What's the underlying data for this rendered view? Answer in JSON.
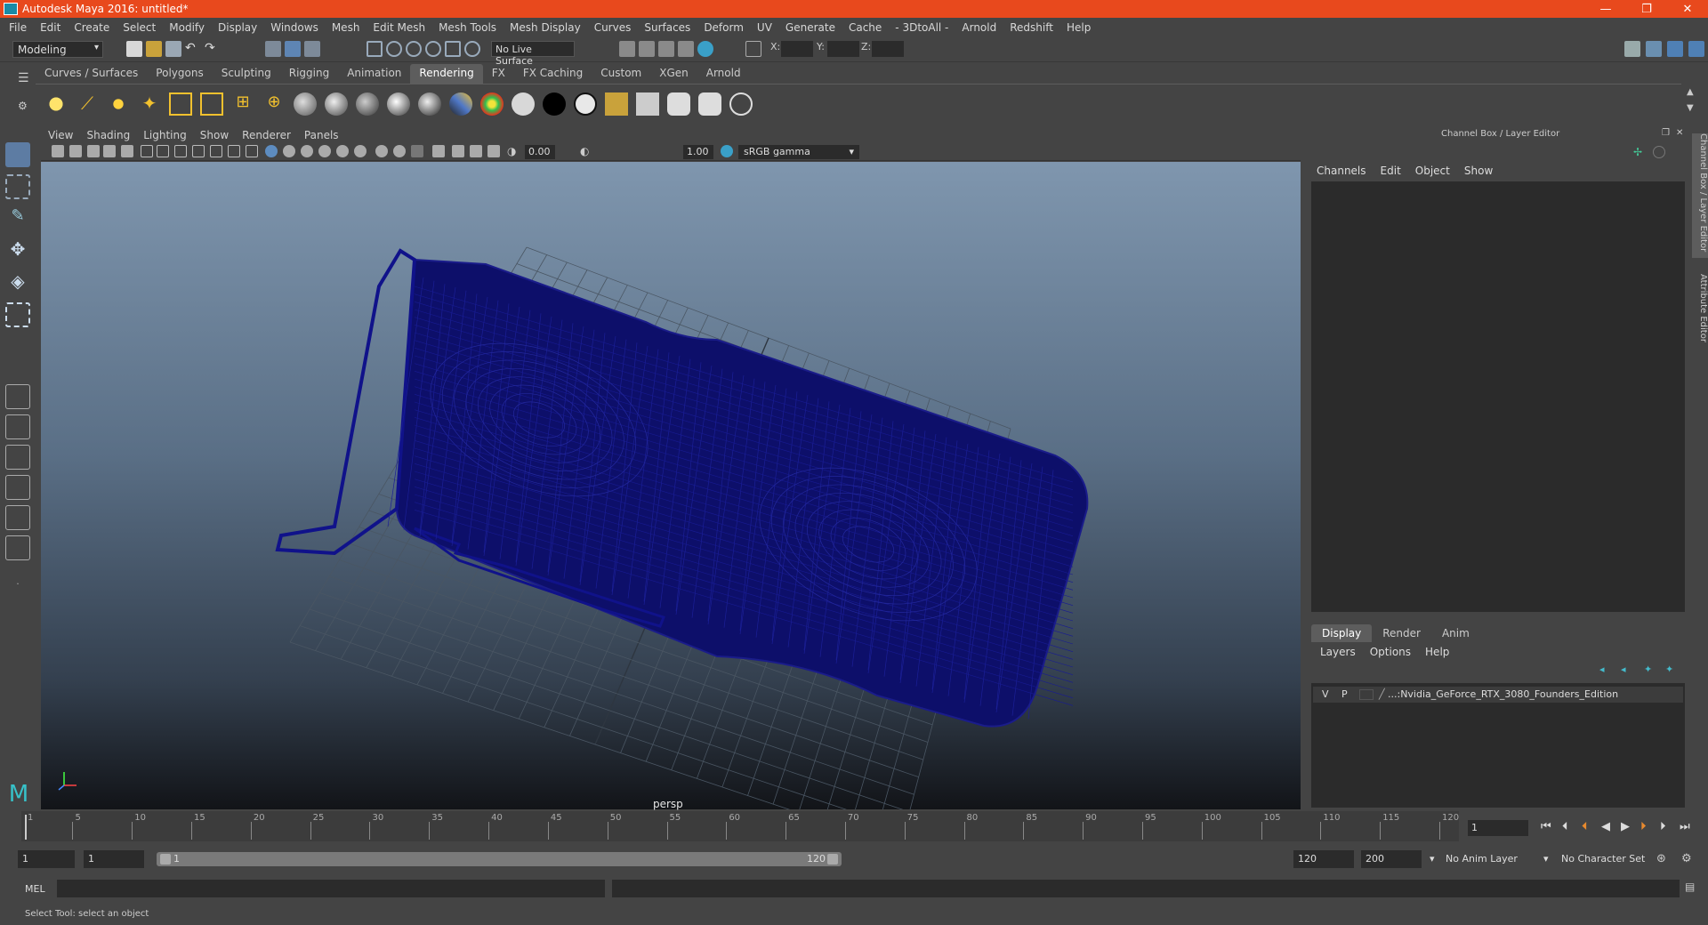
{
  "window": {
    "title": "Autodesk Maya 2016: untitled*",
    "buttons": [
      "—",
      "❐",
      "✕"
    ]
  },
  "menubar": [
    "File",
    "Edit",
    "Create",
    "Select",
    "Modify",
    "Display",
    "Windows",
    "Mesh",
    "Edit Mesh",
    "Mesh Tools",
    "Mesh Display",
    "Curves",
    "Surfaces",
    "Deform",
    "UV",
    "Generate",
    "Cache",
    "- 3DtoAll -",
    "Arnold",
    "Redshift",
    "Help"
  ],
  "statusline": {
    "mode": "Modeling",
    "live_surface": "No Live Surface",
    "x_label": "X:",
    "y_label": "Y:",
    "z_label": "Z:"
  },
  "shelf": {
    "tabs": [
      "Curves / Surfaces",
      "Polygons",
      "Sculpting",
      "Rigging",
      "Animation",
      "Rendering",
      "FX",
      "FX Caching",
      "Custom",
      "XGen",
      "Arnold"
    ],
    "active_tab": "Rendering"
  },
  "viewport": {
    "menu": [
      "View",
      "Shading",
      "Lighting",
      "Show",
      "Renderer",
      "Panels"
    ],
    "exposure": "0.00",
    "gamma_value": "1.00",
    "color_space": "sRGB gamma",
    "camera": "persp"
  },
  "right_panel": {
    "title": "Channel Box / Layer Editor",
    "menu": [
      "Channels",
      "Edit",
      "Object",
      "Show"
    ],
    "layer_tabs": [
      "Display",
      "Render",
      "Anim"
    ],
    "active_layer_tab": "Display",
    "layer_menu": [
      "Layers",
      "Options",
      "Help"
    ],
    "layer_row": {
      "v": "V",
      "p": "P",
      "name": "...:Nvidia_GeForce_RTX_3080_Founders_Edition"
    },
    "side_tabs": [
      "Channel Box / Layer Editor",
      "Attribute Editor"
    ]
  },
  "timeline": {
    "ticks": [
      "1",
      "5",
      "10",
      "15",
      "20",
      "25",
      "30",
      "35",
      "40",
      "45",
      "50",
      "55",
      "60",
      "65",
      "70",
      "75",
      "80",
      "85",
      "90",
      "95",
      "100",
      "105",
      "110",
      "115",
      "120"
    ],
    "current_frame": "1",
    "playback": [
      "⏮",
      "⏭",
      "|◀",
      "◀",
      "▶",
      "▶|",
      "⏭",
      "⏭"
    ]
  },
  "range": {
    "start": "1",
    "playback_start": "1",
    "slider_start": "1",
    "slider_end": "120",
    "playback_end": "120",
    "end": "200",
    "anim_layer": "No Anim Layer",
    "character_set": "No Character Set"
  },
  "command": {
    "label": "MEL"
  },
  "help": {
    "text": "Select Tool: select an object"
  }
}
